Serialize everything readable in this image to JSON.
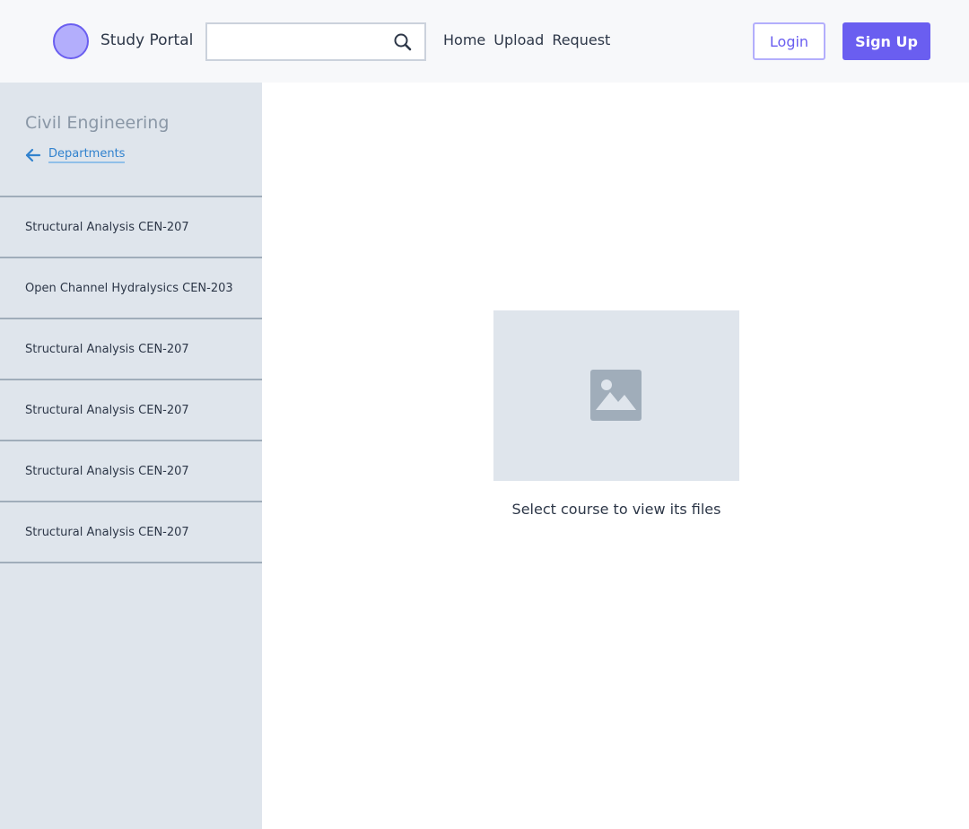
{
  "header": {
    "brand": "Study Portal",
    "search": {
      "value": "",
      "placeholder": ""
    },
    "nav": [
      {
        "label": "Home"
      },
      {
        "label": "Upload"
      },
      {
        "label": "Request"
      }
    ],
    "login_label": "Login",
    "signup_label": "Sign Up"
  },
  "sidebar": {
    "department_title": "Civil Engineering",
    "back_label": "Departments",
    "courses": [
      {
        "label": "Structural Analysis CEN-207"
      },
      {
        "label": "Open Channel Hydralysics CEN-203"
      },
      {
        "label": "Structural Analysis CEN-207"
      },
      {
        "label": "Structural Analysis CEN-207"
      },
      {
        "label": "Structural Analysis CEN-207"
      },
      {
        "label": "Structural Analysis CEN-207"
      }
    ]
  },
  "main": {
    "empty_message": "Select course to view its files",
    "placeholder_icon": "image-icon"
  },
  "colors": {
    "accent": "#6a5ef0",
    "accent_light": "#b3aefc",
    "link": "#3182ce",
    "sidebar_bg": "#dfe5ec",
    "header_bg": "#f7f8fa",
    "text": "#2d3748"
  }
}
